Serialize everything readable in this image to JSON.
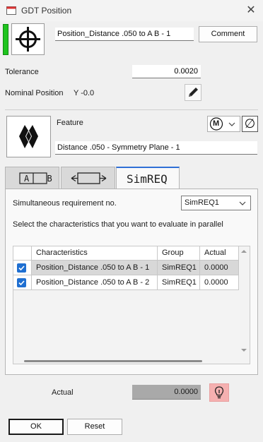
{
  "window": {
    "title": "GDT Position",
    "close_glyph": "✕"
  },
  "header": {
    "characteristic_name": "Position_Distance .050 to A B - 1",
    "comment_label": "Comment",
    "status_color": "#1fc41f",
    "symbol_icon": "true-position-icon"
  },
  "tolerance": {
    "label": "Tolerance",
    "value": "0.0020"
  },
  "nominal": {
    "label": "Nominal Position",
    "value": "Y -0.0",
    "edit_icon": "pencil-icon"
  },
  "feature": {
    "label": "Feature",
    "name": "Distance .050 - Symmetry Plane - 1",
    "modifier_glyph": "M",
    "diameter_glyph": "∅",
    "feature_icon": "symmetry-plane-icon"
  },
  "tabs": [
    {
      "label": "A B",
      "icon": "datum-ref-icon",
      "active": false
    },
    {
      "label": "",
      "icon": "tolerance-zone-icon",
      "active": false
    },
    {
      "label": "SimREQ",
      "active": true
    }
  ],
  "simreq": {
    "req_label": "Simultaneous requirement no.",
    "req_value": "SimREQ1",
    "instructions": "Select the characteristics that you want to evaluate in parallel",
    "columns": [
      "Characteristics",
      "Group",
      "Actual"
    ],
    "rows": [
      {
        "checked": true,
        "name": "Position_Distance .050 to A B - 1",
        "group": "SimREQ1",
        "actual": "0.0000"
      },
      {
        "checked": true,
        "name": "Position_Distance .050 to A B - 2",
        "group": "SimREQ1",
        "actual": "0.0000"
      }
    ]
  },
  "result": {
    "label": "Actual",
    "value": "0.0000",
    "alert_color": "#f5b0b0",
    "icon": "lightbulb-icon"
  },
  "footer": {
    "ok_label": "OK",
    "reset_label": "Reset"
  }
}
